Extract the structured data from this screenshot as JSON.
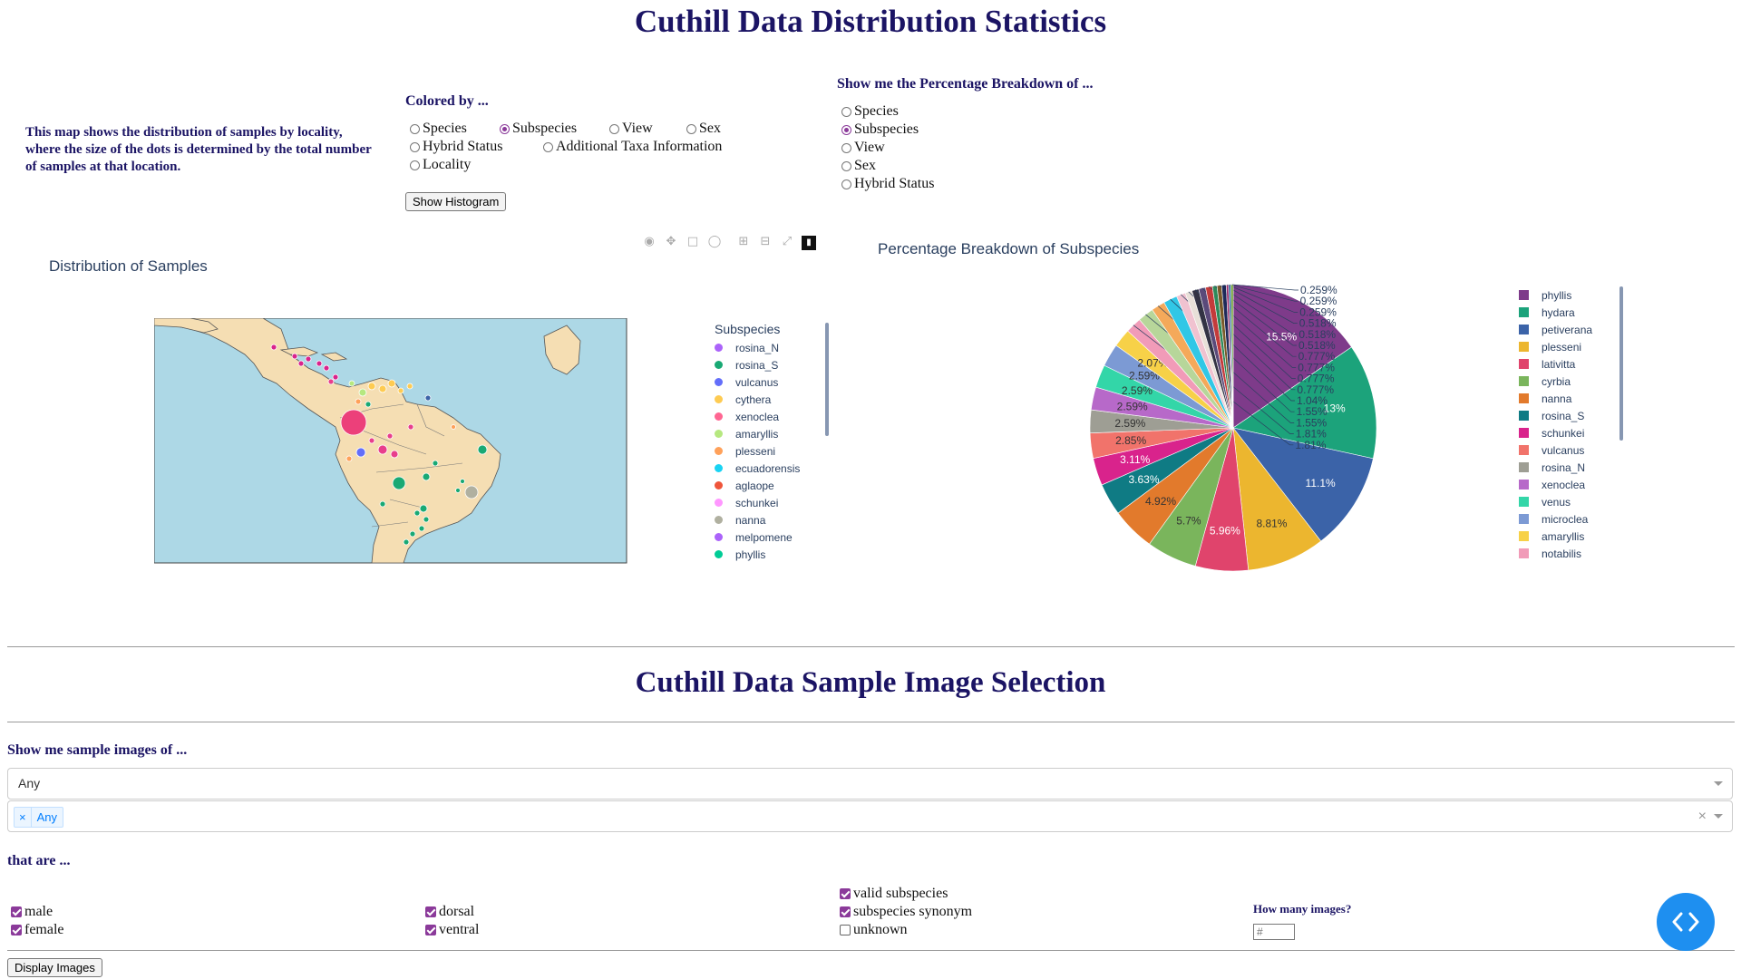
{
  "stats": {
    "title": "Cuthill Data Distribution Statistics",
    "blurb": "This map shows the distribution of samples by locality, where the size of the dots is determined by the total number of samples at that location.",
    "colored_by_label": "Colored by ...",
    "colored_by_options": [
      "Species",
      "Subspecies",
      "View",
      "Sex",
      "Hybrid Status",
      "Additional Taxa Information",
      "Locality"
    ],
    "colored_by_selected": "Subspecies",
    "show_histogram": "Show Histogram",
    "breakdown_label": "Show me the Percentage Breakdown of ...",
    "breakdown_options": [
      "Species",
      "Subspecies",
      "View",
      "Sex",
      "Hybrid Status"
    ],
    "breakdown_selected": "Subspecies"
  },
  "map_chart": {
    "title": "Distribution of Samples",
    "legend_title": "Subspecies",
    "legend": [
      {
        "name": "rosina_N",
        "color": "#ab63fa"
      },
      {
        "name": "rosina_S",
        "color": "#19a974"
      },
      {
        "name": "vulcanus",
        "color": "#636efa"
      },
      {
        "name": "cythera",
        "color": "#fecb52"
      },
      {
        "name": "xenoclea",
        "color": "#ff6692"
      },
      {
        "name": "amaryllis",
        "color": "#b6e880"
      },
      {
        "name": "plesseni",
        "color": "#ffa15a"
      },
      {
        "name": "ecuadorensis",
        "color": "#19d3f3"
      },
      {
        "name": "aglaope",
        "color": "#ef553b"
      },
      {
        "name": "schunkei",
        "color": "#ff97ff"
      },
      {
        "name": "nanna",
        "color": "#b0b0a0"
      },
      {
        "name": "melpomene",
        "color": "#ab63fa"
      },
      {
        "name": "phyllis",
        "color": "#00cc96"
      }
    ]
  },
  "chart_data": {
    "type": "pie",
    "title": "Percentage Breakdown of Subspecies",
    "slices": [
      {
        "label": "phyllis",
        "value": 15.5,
        "text": "15.5%",
        "color": "#7e3b8a"
      },
      {
        "label": "hydara",
        "value": 13,
        "text": "13%",
        "color": "#1ca37b"
      },
      {
        "label": "petiverana",
        "value": 11.1,
        "text": "11.1%",
        "color": "#3b63a8"
      },
      {
        "label": "plesseni",
        "value": 8.81,
        "text": "8.81%",
        "color": "#ecb62f"
      },
      {
        "label": "lativitta",
        "value": 5.96,
        "text": "5.96%",
        "color": "#e0446c"
      },
      {
        "label": "cyrbia",
        "value": 5.7,
        "text": "5.7%",
        "color": "#7ab55c"
      },
      {
        "label": "nanna",
        "value": 4.92,
        "text": "4.92%",
        "color": "#e27a2c"
      },
      {
        "label": "rosina_S",
        "value": 3.63,
        "text": "3.63%",
        "color": "#0f7b84"
      },
      {
        "label": "schunkei",
        "value": 3.11,
        "text": "3.11%",
        "color": "#d9238c"
      },
      {
        "label": "vulcanus",
        "value": 2.85,
        "text": "2.85%",
        "color": "#f1736b"
      },
      {
        "label": "rosina_N",
        "value": 2.59,
        "text": "2.59%",
        "color": "#9e9e94"
      },
      {
        "label": "xenoclea",
        "value": 2.59,
        "text": "2.59%",
        "color": "#b769c9"
      },
      {
        "label": "venus",
        "value": 2.59,
        "text": "2.59%",
        "color": "#33d6a8"
      },
      {
        "label": "microclea",
        "value": 2.59,
        "text": "2.59%",
        "color": "#7c9ad4"
      },
      {
        "label": "amaryllis",
        "value": 2.07,
        "text": "2.07%",
        "color": "#f7d148"
      },
      {
        "label": "notabilis",
        "value": 1.81,
        "text": "1.81%",
        "color": "#f19bb8"
      },
      {
        "label": "",
        "value": 1.81,
        "text": "1.81%",
        "color": "#b7d69a"
      },
      {
        "label": "",
        "value": 1.55,
        "text": "1.55%",
        "color": "#f4a95a"
      },
      {
        "label": "",
        "value": 1.55,
        "text": "1.55%",
        "color": "#31c7e6"
      },
      {
        "label": "",
        "value": 1.04,
        "text": "1.04%",
        "color": "#f0c2d0"
      },
      {
        "label": "",
        "value": 0.777,
        "text": "0.777%",
        "color": "#e8e0d8"
      },
      {
        "label": "",
        "value": 0.777,
        "text": "0.777%",
        "color": "#333344"
      },
      {
        "label": "",
        "value": 0.777,
        "text": "0.777%",
        "color": "#5a4a7a"
      },
      {
        "label": "",
        "value": 0.777,
        "text": "0.777%",
        "color": "#c43b3b"
      },
      {
        "label": "",
        "value": 0.518,
        "text": "0.518%",
        "color": "#2d8a5a"
      },
      {
        "label": "",
        "value": 0.518,
        "text": "0.518%",
        "color": "#7a5a2a"
      },
      {
        "label": "",
        "value": 0.518,
        "text": "0.518%",
        "color": "#1e2a5a"
      },
      {
        "label": "",
        "value": 0.259,
        "text": "0.259%",
        "color": "#9a2a6a"
      },
      {
        "label": "",
        "value": 0.259,
        "text": "0.259%",
        "color": "#2a6a9a"
      },
      {
        "label": "",
        "value": 0.259,
        "text": "0.259%",
        "color": "#6a9a2a"
      }
    ]
  },
  "selection": {
    "title": "Cuthill Data Sample Image Selection",
    "show_label": "Show me sample images of ...",
    "dropdown_value": "Any",
    "multi_chip": "Any",
    "chip_remove": "×",
    "clear_glyph": "×",
    "that_are_label": "that are ...",
    "sex": [
      {
        "label": "male",
        "checked": true
      },
      {
        "label": "female",
        "checked": true
      }
    ],
    "view": [
      {
        "label": "dorsal",
        "checked": true
      },
      {
        "label": "ventral",
        "checked": true
      }
    ],
    "status": [
      {
        "label": "valid subspecies",
        "checked": true
      },
      {
        "label": "subspecies synonym",
        "checked": true
      },
      {
        "label": "unknown",
        "checked": false
      }
    ],
    "how_many_label": "How many images?",
    "how_many_placeholder": "#",
    "display_button": "Display Images",
    "fab_icon": "code-icon"
  }
}
